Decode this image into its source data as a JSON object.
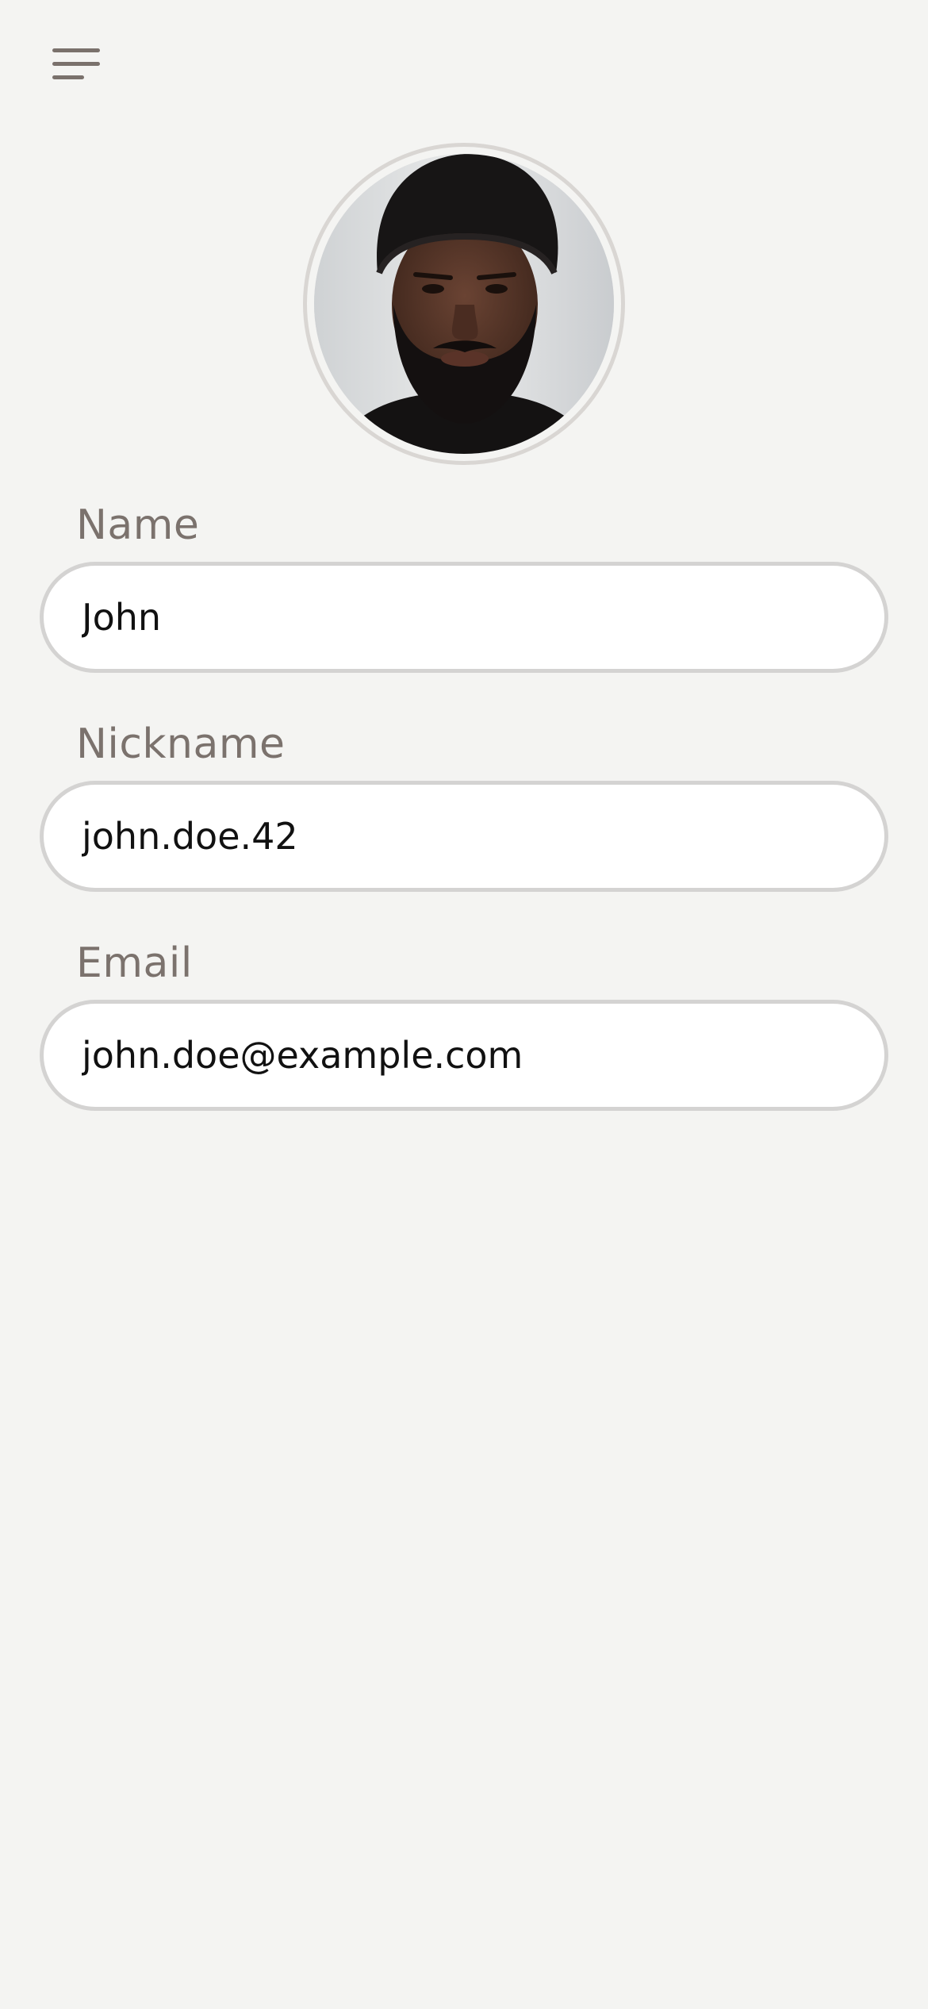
{
  "header": {
    "menu_icon": "hamburger-menu-icon"
  },
  "profile": {
    "avatar_alt": "Profile photo"
  },
  "form": {
    "name": {
      "label": "Name",
      "value": "John"
    },
    "nickname": {
      "label": "Nickname",
      "value": "john.doe.42"
    },
    "email": {
      "label": "Email",
      "value": "john.doe@example.com"
    }
  },
  "colors": {
    "background": "#f4f4f2",
    "label_text": "#7b726d",
    "input_border": "#d4d3d2",
    "input_background": "#ffffff",
    "avatar_ring": "#d9d6d3"
  }
}
